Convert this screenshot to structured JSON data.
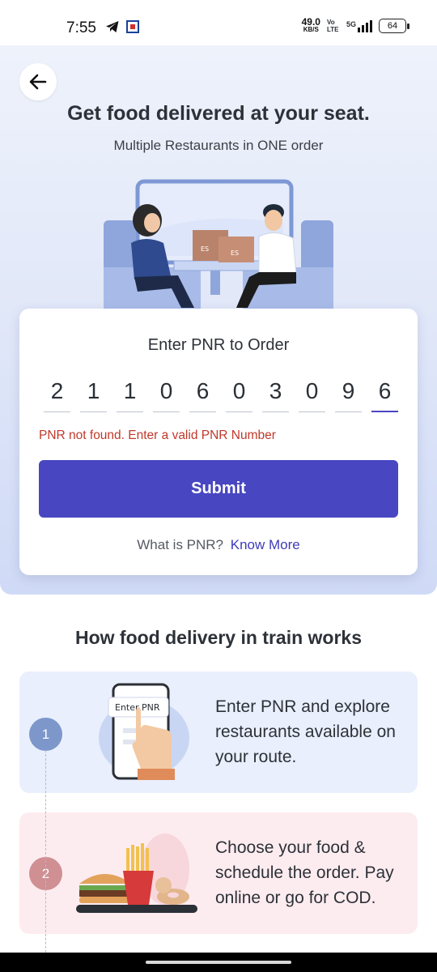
{
  "status_bar": {
    "time": "7:55",
    "net_speed_value": "49.0",
    "net_speed_unit": "KB/S",
    "volte": "Vo LTE",
    "network": "5G",
    "battery": "64"
  },
  "hero": {
    "title": "Get food delivered at your seat.",
    "subtitle": "Multiple Restaurants in ONE order",
    "box_label_1": "ES",
    "box_label_2": "ES"
  },
  "pnr_form": {
    "title": "Enter PNR to Order",
    "digits": [
      "2",
      "1",
      "1",
      "0",
      "6",
      "0",
      "3",
      "0",
      "9",
      "6"
    ],
    "error": "PNR not found. Enter a valid PNR Number",
    "submit_label": "Submit",
    "help_text": "What is PNR?",
    "help_link": "Know More"
  },
  "how_it_works": {
    "title": "How food delivery in train works",
    "steps": [
      {
        "number": "1",
        "text": "Enter PNR and explore restaurants available on your route.",
        "art_label": "Enter PNR"
      },
      {
        "number": "2",
        "text": "Choose your food & schedule the order. Pay online or go for COD."
      }
    ]
  },
  "colors": {
    "primary": "#4846c1",
    "error": "#c0392b",
    "link": "#3f3cb8",
    "step1_bg": "#e9effc",
    "step2_bg": "#fdecef"
  }
}
